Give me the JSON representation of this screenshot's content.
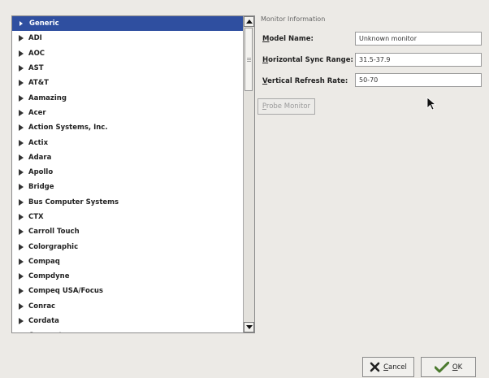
{
  "monitor_list": {
    "items": [
      {
        "label": "Generic",
        "selected": true
      },
      {
        "label": "ADI"
      },
      {
        "label": "AOC"
      },
      {
        "label": "AST"
      },
      {
        "label": "AT&T"
      },
      {
        "label": "Aamazing"
      },
      {
        "label": "Acer"
      },
      {
        "label": "Action Systems, Inc."
      },
      {
        "label": "Actix"
      },
      {
        "label": "Adara"
      },
      {
        "label": "Apollo"
      },
      {
        "label": "Bridge"
      },
      {
        "label": "Bus Computer Systems"
      },
      {
        "label": "CTX"
      },
      {
        "label": "Carroll Touch"
      },
      {
        "label": "Colorgraphic"
      },
      {
        "label": "Compaq"
      },
      {
        "label": "Compdyne"
      },
      {
        "label": "Compeq USA/Focus"
      },
      {
        "label": "Conrac"
      },
      {
        "label": "Cordata"
      },
      {
        "label": "Cornerstone"
      }
    ]
  },
  "monitor_info": {
    "section_title": "Monitor Information",
    "model_name_label_mn": "M",
    "model_name_label_rest": "odel Name:",
    "model_name_value": "Unknown monitor",
    "hsync_label_mn": "H",
    "hsync_label_rest": "orizontal Sync Range:",
    "hsync_value": "31.5-37.9",
    "vrefresh_label_mn": "V",
    "vrefresh_label_rest": "ertical Refresh Rate:",
    "vrefresh_value": "50-70",
    "probe_label_mn": "P",
    "probe_label_rest": "robe Monitor"
  },
  "buttons": {
    "cancel_mn": "C",
    "cancel_rest": "ancel",
    "ok_mn": "O",
    "ok_rest": "K"
  },
  "colors": {
    "selection": "#2f4fa0",
    "background": "#eceae6"
  }
}
